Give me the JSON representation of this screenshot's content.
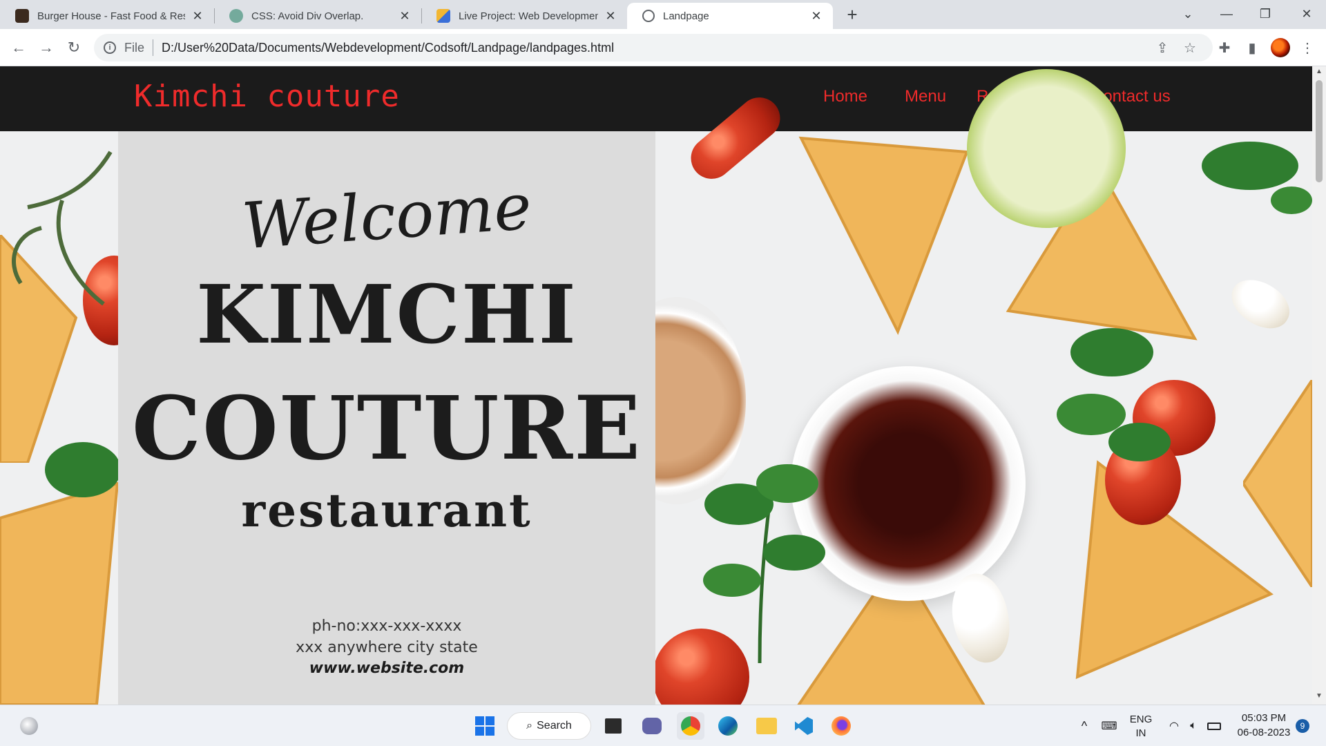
{
  "browser": {
    "tabs": [
      {
        "title": "Burger House - Fast Food & Rest",
        "favicon_color": "#3b2a1e",
        "active": false
      },
      {
        "title": "CSS: Avoid Div Overlap.",
        "favicon_color": "#74aa9c",
        "active": false
      },
      {
        "title": "Live Project: Web Development -",
        "favicon_color": "#f2b632",
        "active": false
      },
      {
        "title": "Landpage",
        "favicon_color": "#5f6368",
        "active": true
      }
    ],
    "close_glyph": "✕",
    "new_tab_glyph": "+",
    "address": {
      "scheme_label": "File",
      "url": "D:/User%20Data/Documents/Webdevelopment/Codsoft/Landpage/landpages.html"
    }
  },
  "site": {
    "brand": "Kimchi  couture",
    "nav": [
      "Home",
      "Menu",
      "Reservation",
      "Contact us"
    ],
    "hero": {
      "welcome": "Welcome",
      "title_line1": "KIMCHI",
      "title_line2": "COUTURE",
      "subtitle": "restaurant",
      "phone": "ph-no:xxx-xxx-xxxx",
      "address": "xxx anywhere city state",
      "website": "www.website.com"
    }
  },
  "taskbar": {
    "search_label": "Search",
    "language_top": "ENG",
    "language_bottom": "IN",
    "time": "05:03 PM",
    "date": "06-08-2023",
    "notification_count": "9"
  },
  "colors": {
    "brand_red": "#ef2b2b",
    "header_bg": "#1b1b1b",
    "panel_bg": "#dcdcdc"
  }
}
